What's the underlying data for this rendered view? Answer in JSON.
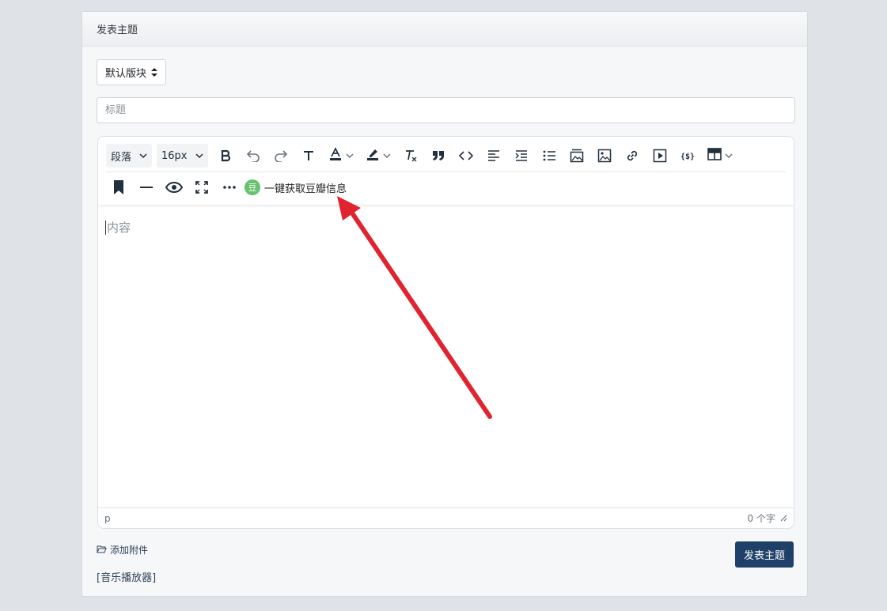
{
  "card": {
    "header_title": "发表主题"
  },
  "form": {
    "forum_select_value": "默认版块",
    "title_placeholder": "标题",
    "content_placeholder": "内容",
    "attach_label": "添加附件",
    "music_link": "[音乐播放器]",
    "submit_label": "发表主题"
  },
  "toolbar": {
    "block_format": "段落",
    "font_size": "16px",
    "douban_badge": "豆",
    "douban_label": "一键获取豆瓣信息",
    "icons": {
      "bold": "bold-icon",
      "undo": "undo-icon",
      "redo": "redo-icon",
      "text": "text-format-icon",
      "font_color": "font-color-icon",
      "highlight": "highlight-icon",
      "clear_format": "clear-format-icon",
      "blockquote": "quote-icon",
      "code": "code-icon",
      "align_left": "align-left-icon",
      "indent": "indent-icon",
      "bullet_list": "bullet-list-icon",
      "gallery": "gallery-icon",
      "image": "image-icon",
      "link": "link-icon",
      "media": "media-icon",
      "code_sample": "code-sample-icon",
      "table": "table-icon",
      "bookmark": "bookmark-icon",
      "hr": "horizontal-rule-icon",
      "preview": "eye-icon",
      "fullscreen": "fullscreen-icon",
      "more": "more-icon"
    }
  },
  "statusbar": {
    "path": "p",
    "word_count": "0 个字"
  },
  "colors": {
    "submit_bg": "#1f4068",
    "douban_green": "#67c16f",
    "arrow_red": "#e0242f",
    "page_bg": "#dfe3e8"
  }
}
